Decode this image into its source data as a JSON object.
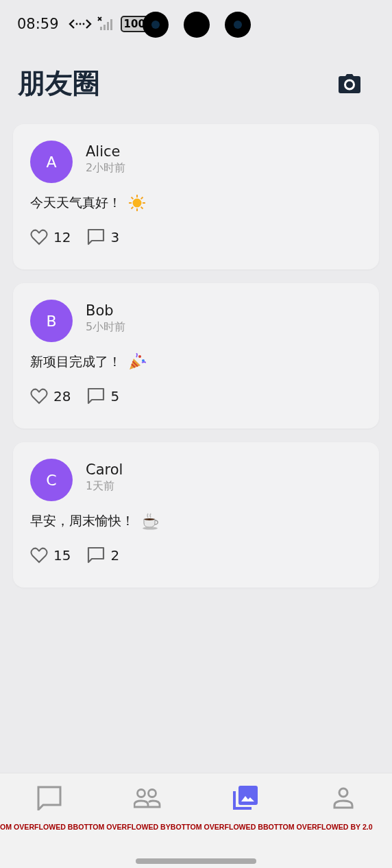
{
  "status_bar": {
    "time": "08:59",
    "battery": "100"
  },
  "header": {
    "title": "朋友圈"
  },
  "posts": [
    {
      "avatar": "A",
      "name": "Alice",
      "time": "2小时前",
      "text": "今天天气真好！",
      "kind": "sun",
      "likes": "12",
      "comments": "3"
    },
    {
      "avatar": "B",
      "name": "Bob",
      "time": "5小时前",
      "text": "新项目完成了！",
      "kind": "party",
      "likes": "28",
      "comments": "5"
    },
    {
      "avatar": "C",
      "name": "Carol",
      "time": "1天前",
      "text": "早安，周末愉快！",
      "kind": "coffee",
      "likes": "15",
      "comments": "2"
    }
  ],
  "bottom_nav": [
    {
      "kind": "chat",
      "selected": false
    },
    {
      "kind": "contacts",
      "selected": false
    },
    {
      "kind": "photos",
      "selected": true
    },
    {
      "kind": "person",
      "selected": false
    }
  ],
  "overflow_warnings": [
    "OM OVERFLOWED B",
    "BOTTOM OVERFLOWED BY",
    "BOTTOM OVERFLOWED B",
    "BOTTOM OVERFLOWED BY 2.0"
  ]
}
